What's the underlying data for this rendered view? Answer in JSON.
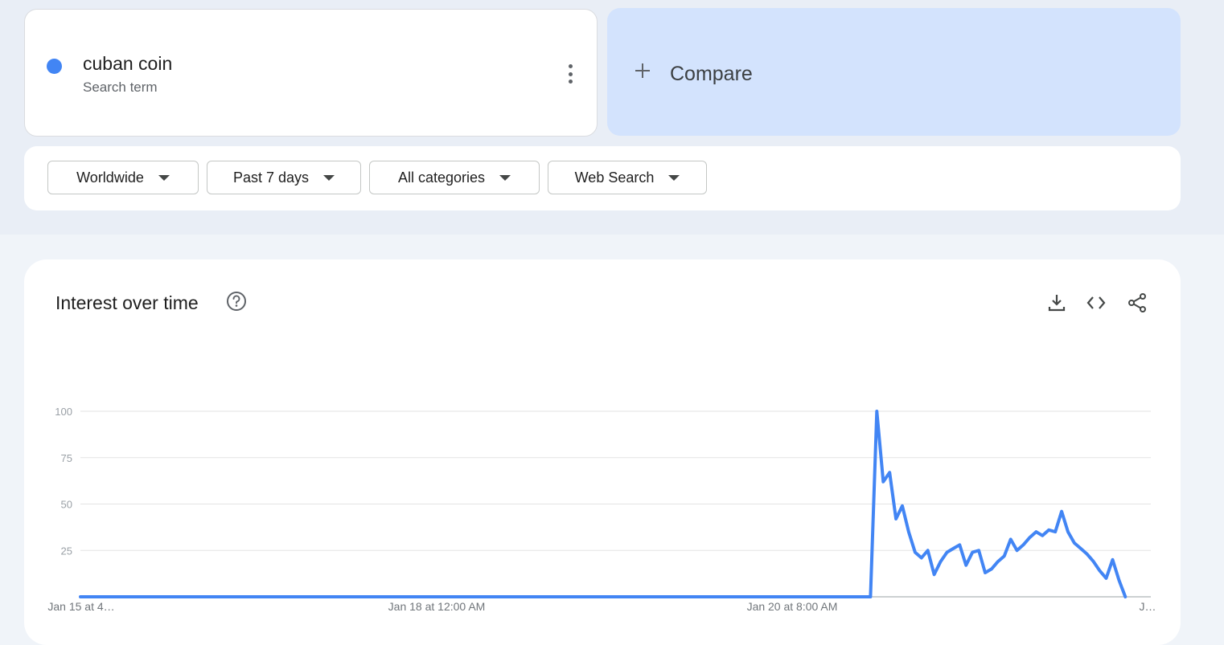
{
  "search_term": {
    "name": "cuban coin",
    "type": "Search term"
  },
  "compare": {
    "label": "Compare"
  },
  "filters": [
    {
      "label": "Worldwide"
    },
    {
      "label": "Past 7 days"
    },
    {
      "label": "All categories"
    },
    {
      "label": "Web Search"
    }
  ],
  "colors": {
    "series": "#4285f4",
    "compare_bg": "#d3e3fd",
    "band_bg": "#e9eef6"
  },
  "icons": [
    "more-vert-icon",
    "plus-icon",
    "help-circle-icon",
    "download-icon",
    "embed-code-icon",
    "share-icon"
  ],
  "chart_section": {
    "title": "Interest over time"
  },
  "chart_data": {
    "type": "line",
    "ylim": [
      0,
      100
    ],
    "yticks": [
      "100",
      "75",
      "50",
      "25"
    ],
    "xtick_labels": [
      "Jan 15 at 4…",
      "Jan 18 at 12:00 AM",
      "Jan 20 at 8:00 AM",
      "J…"
    ],
    "x_count": 168,
    "grid": true,
    "series": [
      {
        "points": [
          [
            0,
            0
          ],
          [
            124,
            0
          ],
          [
            125,
            100
          ],
          [
            126,
            62
          ],
          [
            127,
            67
          ],
          [
            128,
            42
          ],
          [
            129,
            49
          ],
          [
            130,
            35
          ],
          [
            131,
            24
          ],
          [
            132,
            21
          ],
          [
            133,
            25
          ],
          [
            134,
            12
          ],
          [
            135,
            19
          ],
          [
            136,
            24
          ],
          [
            137,
            26
          ],
          [
            138,
            28
          ],
          [
            139,
            17
          ],
          [
            140,
            24
          ],
          [
            141,
            25
          ],
          [
            142,
            13
          ],
          [
            143,
            15
          ],
          [
            144,
            19
          ],
          [
            145,
            22
          ],
          [
            146,
            31
          ],
          [
            147,
            25
          ],
          [
            148,
            28
          ],
          [
            149,
            32
          ],
          [
            150,
            35
          ],
          [
            151,
            33
          ],
          [
            152,
            36
          ],
          [
            153,
            35
          ],
          [
            154,
            46
          ],
          [
            155,
            35
          ],
          [
            156,
            29
          ],
          [
            157,
            26
          ],
          [
            158,
            23
          ],
          [
            159,
            19
          ],
          [
            160,
            14
          ],
          [
            161,
            10
          ],
          [
            162,
            20
          ],
          [
            163,
            9
          ],
          [
            164,
            0
          ]
        ]
      }
    ]
  }
}
